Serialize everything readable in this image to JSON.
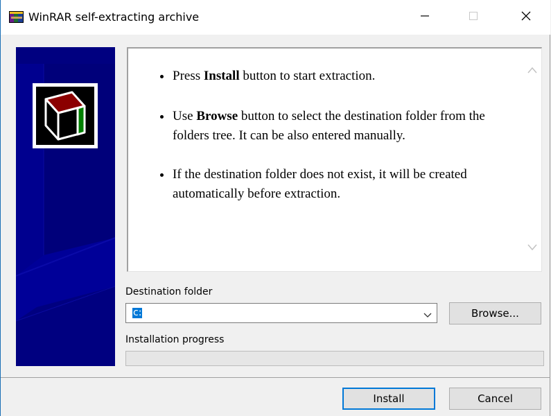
{
  "window": {
    "title": "WinRAR self-extracting archive",
    "controls": [
      "minimize-icon",
      "maximize-icon",
      "close-icon"
    ]
  },
  "info": {
    "items": [
      {
        "before": "Press ",
        "bold": "Install",
        "after": " button to start extraction."
      },
      {
        "before": "Use ",
        "bold": "Browse",
        "after": " button to select the destination folder from the folders tree. It can be also entered manually."
      },
      {
        "before": "If the destination folder does not exist, it will be created automatically before extraction.",
        "bold": "",
        "after": ""
      }
    ]
  },
  "destination": {
    "label": "Destination folder",
    "value": "c:",
    "browse_label": "Browse..."
  },
  "progress": {
    "label": "Installation progress",
    "value": 0
  },
  "buttons": {
    "install": "Install",
    "cancel": "Cancel"
  },
  "colors": {
    "banner": "#000080",
    "accent": "#0078d7",
    "logo_red": "#8b0000",
    "logo_green": "#008000"
  }
}
